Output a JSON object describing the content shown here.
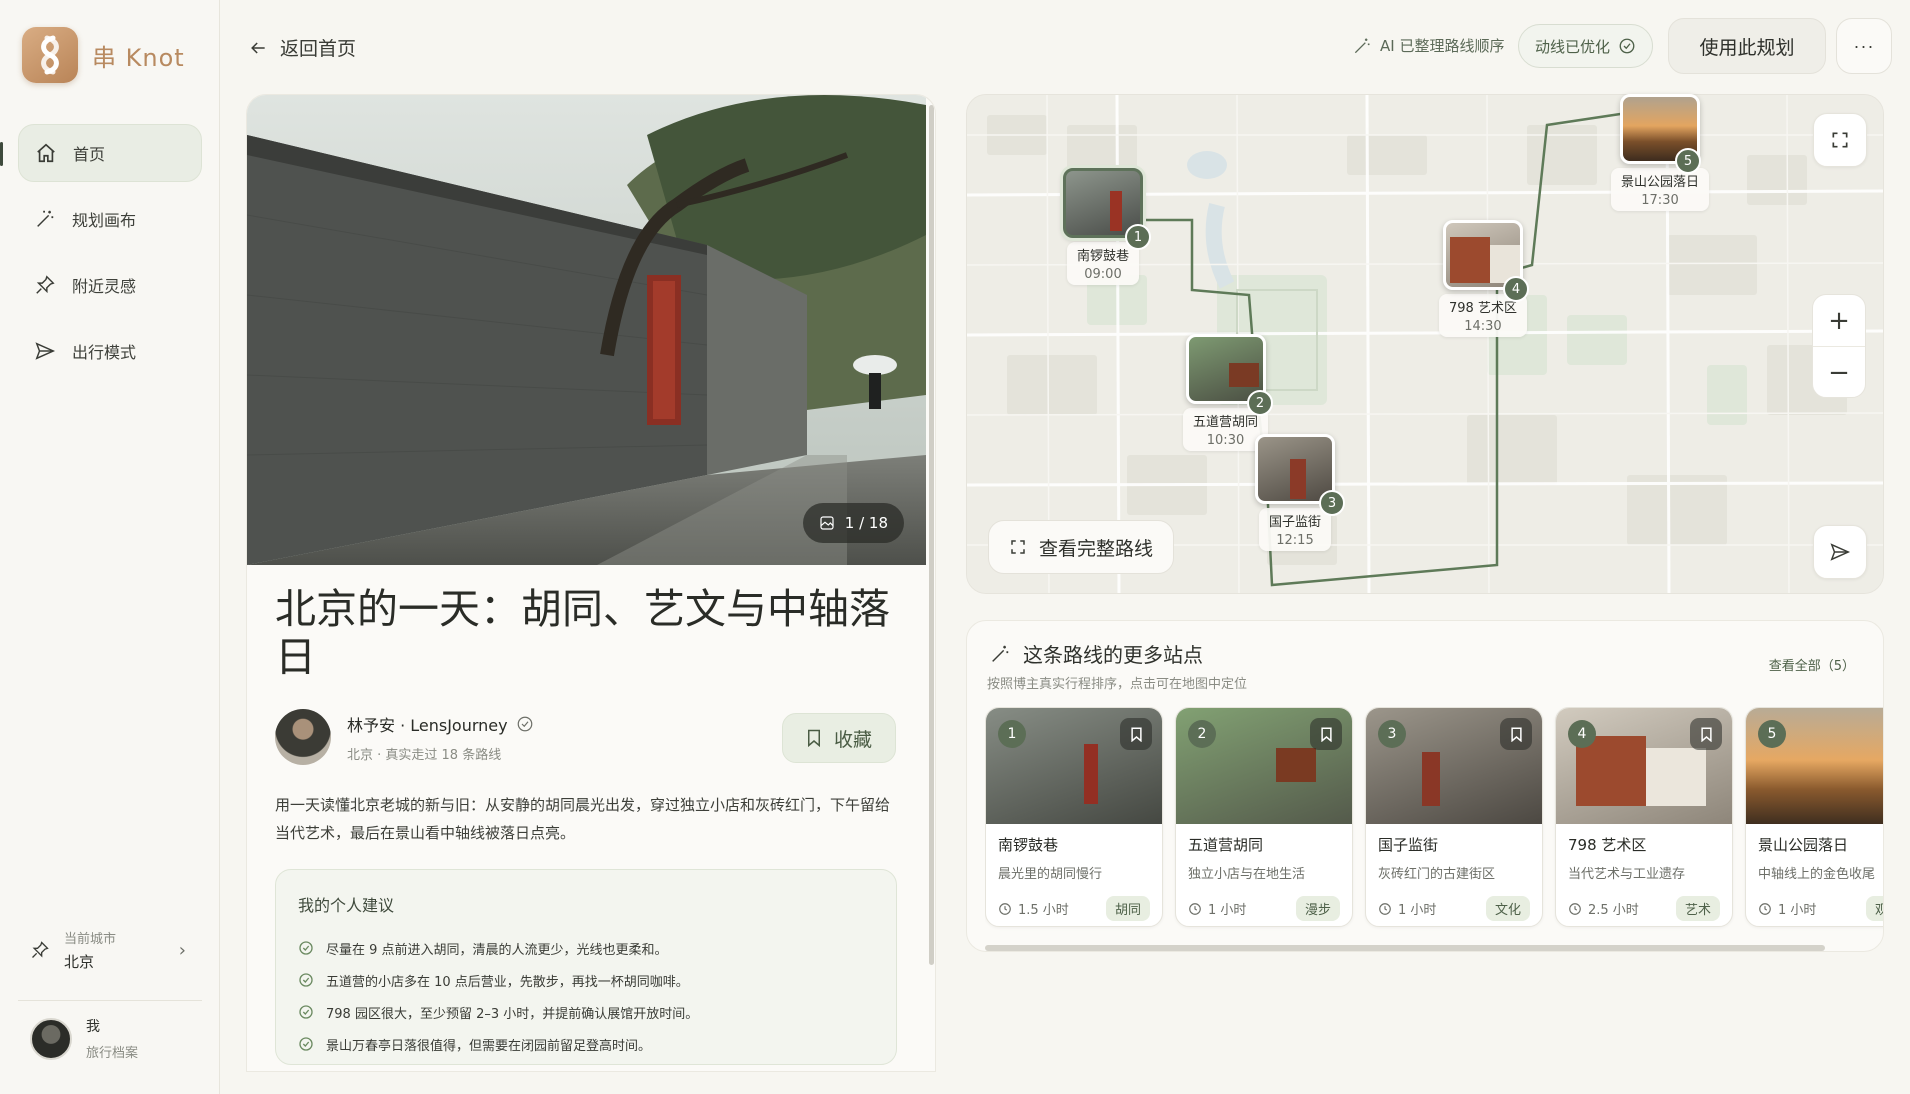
{
  "brand": {
    "name": "串 Knot"
  },
  "nav": {
    "items": [
      {
        "label": "首页",
        "icon": "home-icon"
      },
      {
        "label": "规划画布",
        "icon": "magic-wand-icon"
      },
      {
        "label": "附近灵感",
        "icon": "pin-icon"
      },
      {
        "label": "出行模式",
        "icon": "send-icon"
      }
    ]
  },
  "city": {
    "label": "当前城市",
    "value": "北京"
  },
  "me": {
    "name": "我",
    "sub": "旅行档案"
  },
  "topbar": {
    "back": "返回首页",
    "ai_note": "AI 已整理路线顺序",
    "optimized": "动线已优化",
    "use_plan": "使用此规划",
    "more": "···"
  },
  "article": {
    "photo_count": "1 / 18",
    "title": "北京的一天：胡同、艺文与中轴落日",
    "author": "林予安 · LensJourney",
    "author_meta": "北京 · 真实走过 18 条路线",
    "save": "收藏",
    "desc": "用一天读懂北京老城的新与旧：从安静的胡同晨光出发，穿过独立小店和灰砖红门，下午留给当代艺术，最后在景山看中轴线被落日点亮。",
    "tips_title": "我的个人建议",
    "tips": [
      "尽量在 9 点前进入胡同，清晨的人流更少，光线也更柔和。",
      "五道营的小店多在 10 点后营业，先散步，再找一杯胡同咖啡。",
      "798 园区很大，至少预留 2–3 小时，并提前确认展馆开放时间。",
      "景山万春亭日落很值得，但需要在闭园前留足登高时间。"
    ]
  },
  "map": {
    "view_route": "查看完整路线",
    "stops": [
      {
        "num": "1",
        "name": "南锣鼓巷",
        "time": "09:00"
      },
      {
        "num": "2",
        "name": "五道营胡同",
        "time": "10:30"
      },
      {
        "num": "3",
        "name": "国子监街",
        "time": "12:15"
      },
      {
        "num": "4",
        "name": "798 艺术区",
        "time": "14:30"
      },
      {
        "num": "5",
        "name": "景山公园落日",
        "time": "17:30"
      }
    ]
  },
  "more": {
    "title": "这条路线的更多站点",
    "sub": "按照博主真实行程排序，点击可在地图中定位",
    "view_all": "查看全部（5）",
    "cards": [
      {
        "num": "1",
        "name": "南锣鼓巷",
        "desc": "晨光里的胡同慢行",
        "time": "1.5 小时",
        "tag": "胡同"
      },
      {
        "num": "2",
        "name": "五道营胡同",
        "desc": "独立小店与在地生活",
        "time": "1 小时",
        "tag": "漫步"
      },
      {
        "num": "3",
        "name": "国子监街",
        "desc": "灰砖红门的古建街区",
        "time": "1 小时",
        "tag": "文化"
      },
      {
        "num": "4",
        "name": "798 艺术区",
        "desc": "当代艺术与工业遗存",
        "time": "2.5 小时",
        "tag": "艺术"
      },
      {
        "num": "5",
        "name": "景山公园落日",
        "desc": "中轴线上的金色收尾",
        "time": "1 小时",
        "tag": "观景"
      }
    ]
  },
  "colors": {
    "accent": "#5c6e56",
    "brand": "#c08f62",
    "route": "#5e7a58"
  }
}
